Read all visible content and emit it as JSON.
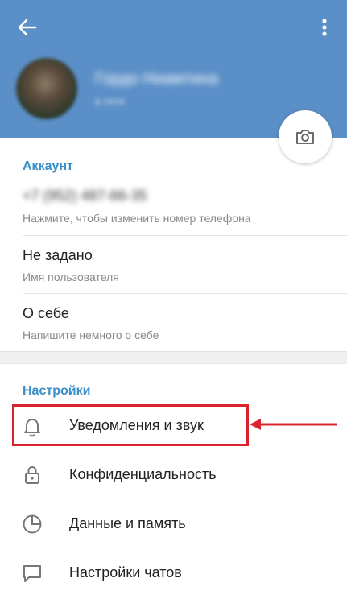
{
  "header": {
    "profile_name": "Гордо Ниамтина",
    "profile_status": "в сети",
    "back_icon": "arrow-left-icon",
    "menu_icon": "more-vert-icon",
    "camera_icon": "camera-icon",
    "colors": {
      "header_bg": "#5b8fc7",
      "accent": "#3a8fc8",
      "highlight": "#d9232e"
    }
  },
  "account": {
    "title": "Аккаунт",
    "phone_value": "+7 (952) 487-66-35",
    "phone_hint": "Нажмите, чтобы изменить номер телефона",
    "username_value": "Не задано",
    "username_hint": "Имя пользователя",
    "bio_value": "О себе",
    "bio_hint": "Напишите немного о себе"
  },
  "settings": {
    "title": "Настройки",
    "items": [
      {
        "label": "Уведомления и звук",
        "icon": "bell-icon"
      },
      {
        "label": "Конфиденциальность",
        "icon": "lock-icon"
      },
      {
        "label": "Данные и память",
        "icon": "clock-pie-icon"
      },
      {
        "label": "Настройки чатов",
        "icon": "chat-bubble-icon"
      }
    ]
  }
}
